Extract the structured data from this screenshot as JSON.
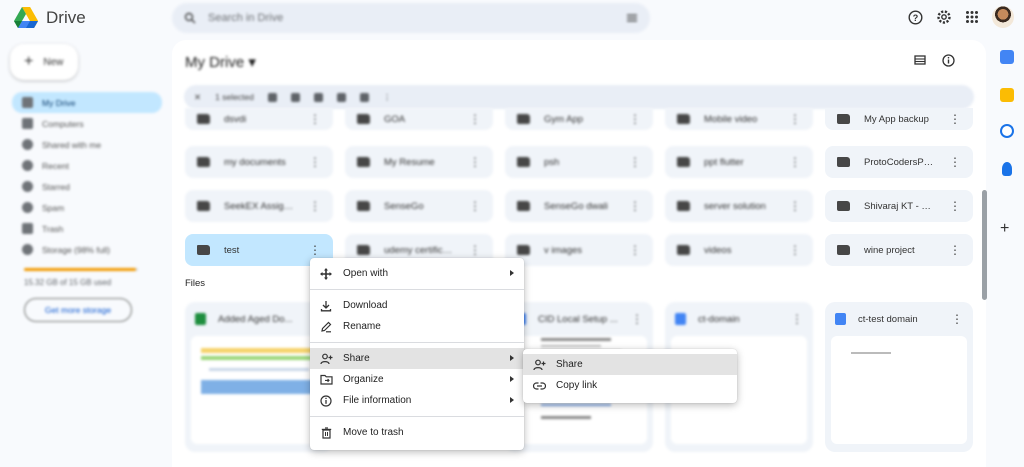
{
  "app": {
    "name": "Drive",
    "search_placeholder": "Search in Drive"
  },
  "sidebar": {
    "new_label": "New",
    "items": [
      {
        "label": "My Drive",
        "active": true
      },
      {
        "label": "Computers"
      },
      {
        "label": "Shared with me"
      },
      {
        "label": "Recent"
      },
      {
        "label": "Starred"
      },
      {
        "label": "Spam"
      },
      {
        "label": "Trash"
      },
      {
        "label": "Storage (98% full)"
      }
    ],
    "storage_used_fraction": 0.98,
    "storage_text": "15.32 GB of 15 GB used",
    "get_storage_label": "Get more storage"
  },
  "main": {
    "title": "My Drive",
    "toolbar_selected": "1 selected",
    "folders": [
      {
        "name": "dsvdi"
      },
      {
        "name": "GOA"
      },
      {
        "name": "Gym App"
      },
      {
        "name": "Mobile video"
      },
      {
        "name": "My App backup"
      },
      {
        "name": "my documents"
      },
      {
        "name": "My Resume"
      },
      {
        "name": "psh"
      },
      {
        "name": "ppt flutter"
      },
      {
        "name": "ProtoCodersPoi..."
      },
      {
        "name": "SeekEX Assignm..."
      },
      {
        "name": "SenseGo"
      },
      {
        "name": "SenseGo dwali"
      },
      {
        "name": "server solution"
      },
      {
        "name": "Shivaraj KT - SD..."
      },
      {
        "name": "test",
        "selected": true
      },
      {
        "name": "udemy certificate"
      },
      {
        "name": "v images"
      },
      {
        "name": "videos"
      },
      {
        "name": "wine project"
      }
    ],
    "files_label": "Files",
    "files": [
      {
        "name": "Added Aged Do...",
        "color": "#1e8e3e"
      },
      {
        "name": "CID Local Setup ...",
        "color": "#4285f4"
      },
      {
        "name": "ct-domain",
        "color": "#4285f4"
      },
      {
        "name": "ct-test domain",
        "color": "#4285f4"
      }
    ]
  },
  "context_menu": {
    "items": [
      {
        "label": "Open with",
        "icon": "move-icon",
        "submenu": true
      },
      {
        "label": "Download",
        "icon": "download-icon"
      },
      {
        "label": "Rename",
        "icon": "pencil-icon"
      },
      {
        "label": "Share",
        "icon": "person-add-icon",
        "submenu": true,
        "highlighted": true
      },
      {
        "label": "Organize",
        "icon": "folder-move-icon",
        "submenu": true
      },
      {
        "label": "File information",
        "icon": "info-icon",
        "submenu": true
      },
      {
        "label": "Move to trash",
        "icon": "trash-icon"
      }
    ]
  },
  "share_submenu": {
    "items": [
      {
        "label": "Share",
        "icon": "person-add-icon",
        "highlighted": true
      },
      {
        "label": "Copy link",
        "icon": "link-icon"
      }
    ]
  },
  "colors": {
    "accent": "#c2e7ff",
    "storage_warning": "#f29900",
    "menu_highlight": "#e3e3e3"
  }
}
